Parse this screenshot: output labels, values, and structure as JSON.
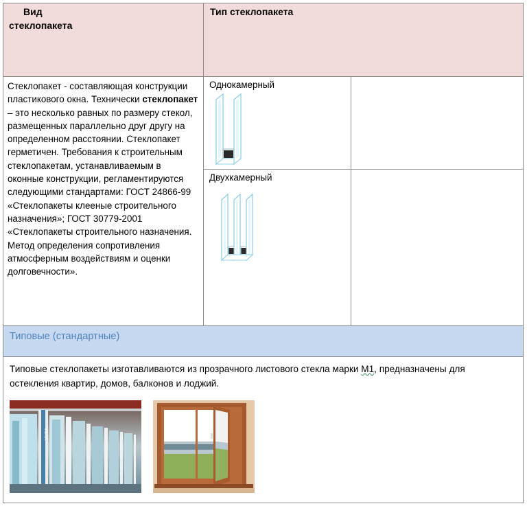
{
  "header": {
    "col1_line1": "Вид",
    "col1_line2": "стеклопакета",
    "col2": "Тип стеклопакета"
  },
  "description": {
    "part1": "Стеклопакет - составляющая конструкции  пластикового окна. Технически ",
    "bold": "стеклопакет",
    "part2": " – это несколько равных по размеру стекол, размещенных параллельно друг другу на определенном расстоянии. Стеклопакет герметичен.    Требования к строительным стеклопакетам, устанавливаемым в  оконные конструкции, регламентируются следующими стандартами: ГОСТ 24866-99 «Стеклопакеты клееные строительного назначения»; ГОСТ 30779-2001 «Стеклопакеты строительного назначения. Метод определения сопротивления атмосферным воздействиям и оценки долговечности»."
  },
  "types": [
    {
      "label": "Однокамерный",
      "icon": "single-chamber-glazing-icon"
    },
    {
      "label": "Двухкамерный",
      "icon": "double-chamber-glazing-icon"
    }
  ],
  "section": {
    "title": "Типовые (стандартные)",
    "text_before": "Типовые   стеклопакеты  изготавливаются из прозрачного листового стекла марки ",
    "grade": "М1",
    "text_after": ", предназначены для остекления квартир, домов, балконов и лоджий."
  },
  "photos": [
    {
      "name": "warehouse-photo",
      "caption": "VEKA"
    },
    {
      "name": "window-photo"
    }
  ],
  "colors": {
    "header_bg": "#f2dcdb",
    "band_bg": "#c6d9f1",
    "band_text": "#4f81bd",
    "border": "#8a8a8a"
  }
}
